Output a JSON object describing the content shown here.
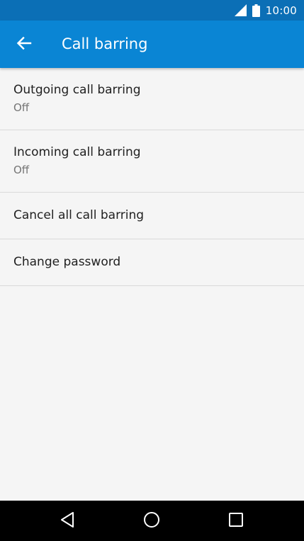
{
  "status_bar": {
    "time": "10:00",
    "icons": [
      "signal-icon",
      "battery-icon"
    ]
  },
  "app_bar": {
    "title": "Call barring",
    "back_icon": "arrow-left-icon"
  },
  "settings": {
    "items": [
      {
        "title": "Outgoing call barring",
        "subtitle": "Off"
      },
      {
        "title": "Incoming call barring",
        "subtitle": "Off"
      },
      {
        "title": "Cancel all call barring"
      },
      {
        "title": "Change password"
      }
    ]
  },
  "nav_bar": {
    "icons": [
      "triangle-back-icon",
      "circle-home-icon",
      "square-recents-icon"
    ]
  },
  "colors": {
    "status_bar": "#0b6fb6",
    "app_bar": "#0a85d4",
    "background": "#f5f5f5",
    "divider": "#d9d9d9",
    "primary_text": "#212121",
    "secondary_text": "#757575",
    "nav_bar": "#000000"
  }
}
